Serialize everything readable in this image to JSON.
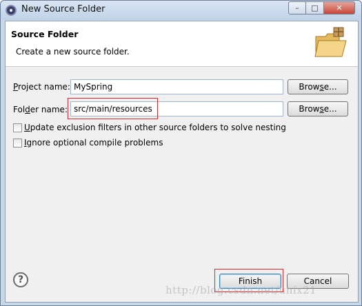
{
  "window": {
    "title": "New Source Folder",
    "minimize_glyph": "–",
    "maximize_glyph": "□",
    "close_glyph": "✕"
  },
  "banner": {
    "title": "Source Folder",
    "description": "Create a new source folder.",
    "icon": "folder-icon"
  },
  "form": {
    "project_name": {
      "label_pre": "",
      "label_mnemonic": "P",
      "label_post": "roject name:",
      "value": "MySpring",
      "browse_pre": "Brow",
      "browse_mnemonic": "s",
      "browse_post": "e..."
    },
    "folder_name": {
      "label_pre": "Fol",
      "label_mnemonic": "d",
      "label_post": "er name:",
      "value": "src/main/resources",
      "browse_pre": "Brow",
      "browse_mnemonic": "s",
      "browse_post": "e..."
    },
    "options": [
      {
        "mnemonic": "U",
        "rest": "pdate exclusion filters in other source folders to solve nesting",
        "checked": false
      },
      {
        "mnemonic": "I",
        "rest": "gnore optional compile problems",
        "checked": false
      }
    ]
  },
  "footer": {
    "help_label": "?",
    "finish_label": "Finish",
    "cancel_label": "Cancel"
  },
  "watermark": "http://blog.csdn.net/unix21",
  "colors": {
    "highlight": "#d9262a",
    "banner_bg": "#ffffff",
    "dialog_bg": "#f0f0f0"
  }
}
